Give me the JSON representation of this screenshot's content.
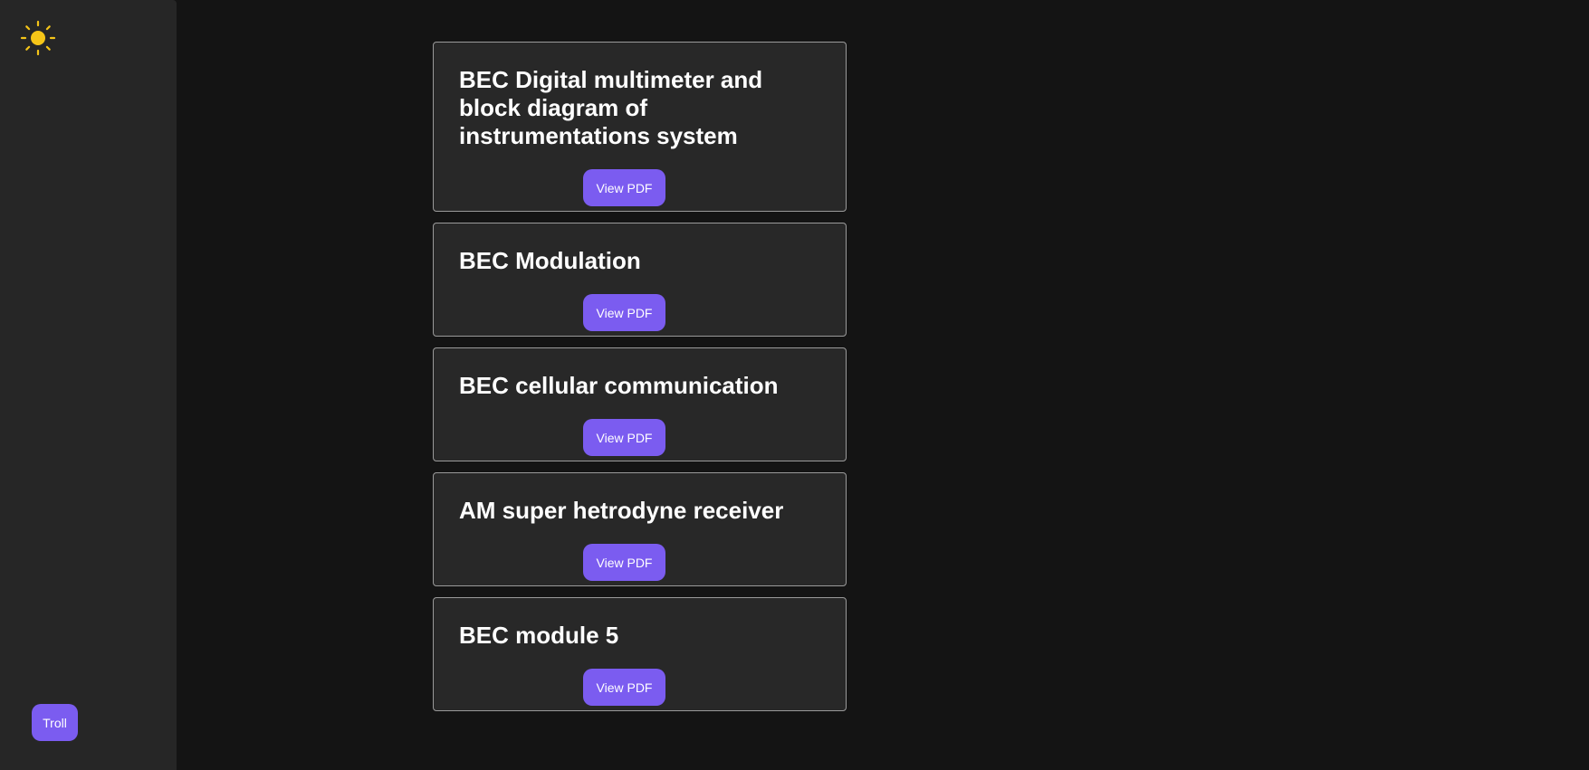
{
  "sidebar": {
    "theme_icon": "sun-icon",
    "theme_icon_color": "#F5C518",
    "troll_label": "Troll"
  },
  "cards": [
    {
      "title": "BEC Digital multimeter and block diagram of instrumentations system",
      "button_label": "View PDF"
    },
    {
      "title": "BEC Modulation",
      "button_label": "View PDF"
    },
    {
      "title": "BEC cellular communication",
      "button_label": "View PDF"
    },
    {
      "title": "AM super hetrodyne receiver",
      "button_label": "View PDF"
    },
    {
      "title": "BEC module 5",
      "button_label": "View PDF"
    }
  ],
  "colors": {
    "background": "#141414",
    "sidebar": "#262626",
    "card": "#282828",
    "accent": "#7B5CF0"
  }
}
